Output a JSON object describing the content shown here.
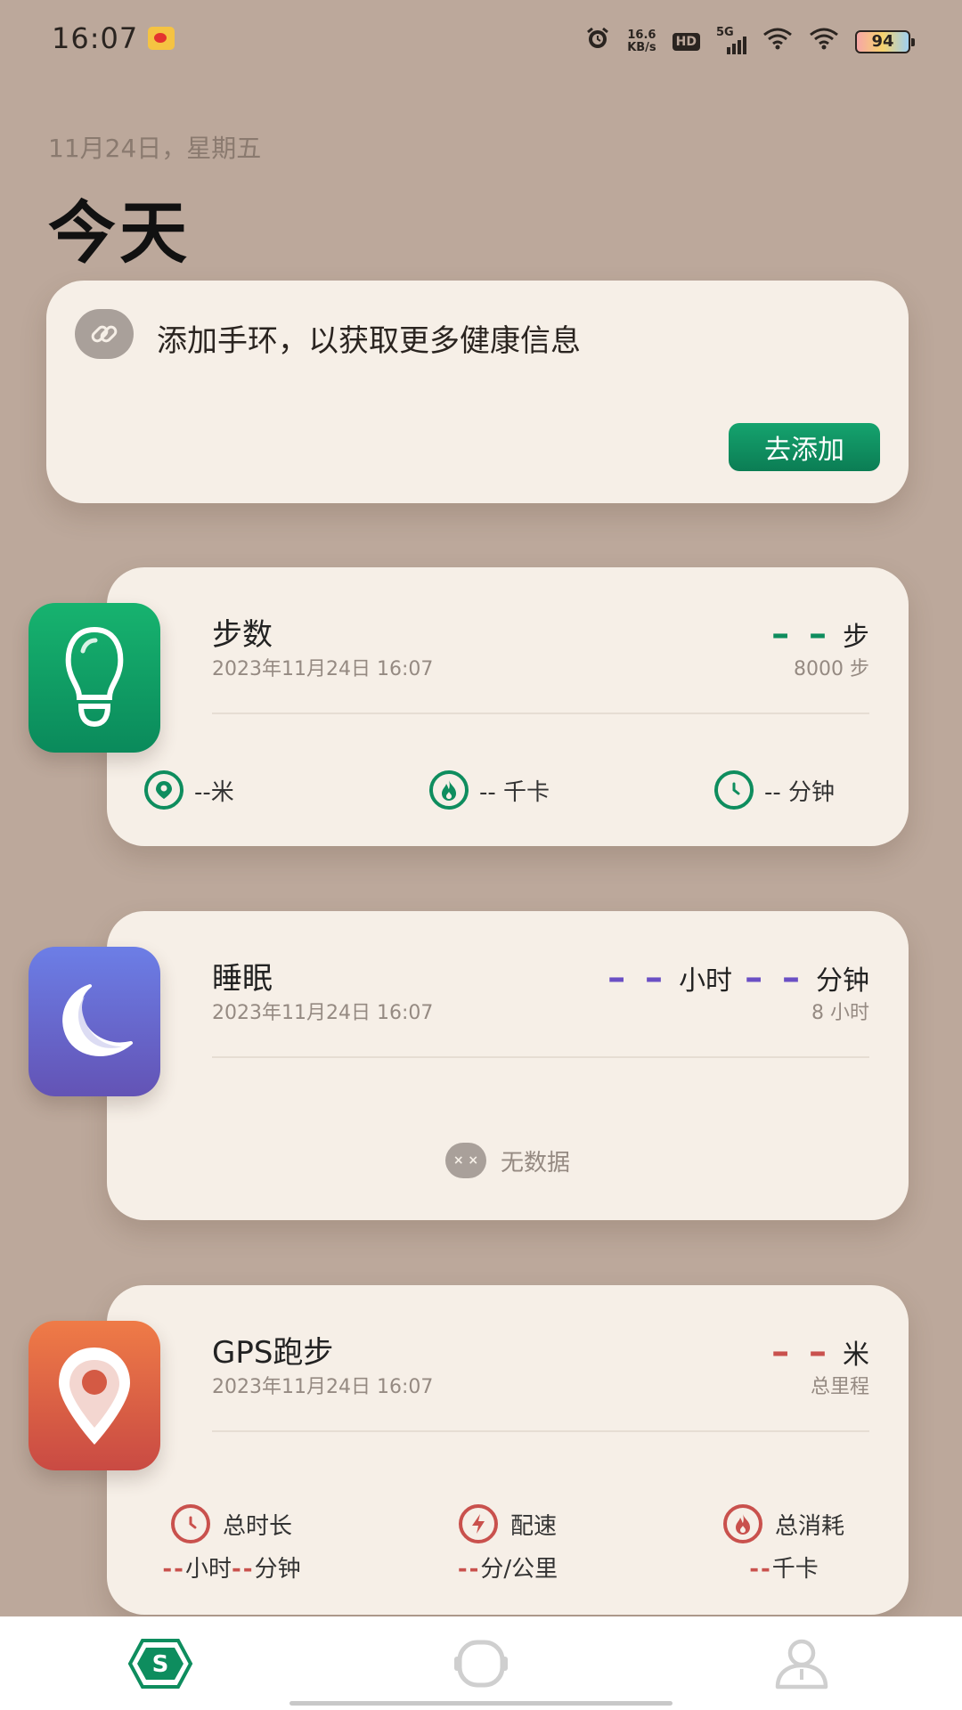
{
  "status_bar": {
    "time": "16:07",
    "net_speed_value": "16.6",
    "net_speed_unit": "KB/s",
    "hd": "HD",
    "network": "5G",
    "battery": "94"
  },
  "header": {
    "date": "11月24日，星期五",
    "title": "今天"
  },
  "band_card": {
    "message": "添加手环，以获取更多健康信息",
    "add_label": "去添加"
  },
  "steps": {
    "title": "步数",
    "time": "2023年11月24日 16:07",
    "value": "– –",
    "unit": "步",
    "goal": "8000 步",
    "accent": "#0e8d5e",
    "stats": [
      {
        "label": "--米"
      },
      {
        "label": "-- 千卡"
      },
      {
        "label": "-- 分钟"
      }
    ]
  },
  "sleep": {
    "title": "睡眠",
    "time": "2023年11月24日 16:07",
    "hours_value": "– –",
    "hours_unit": "小时",
    "minutes_value": "– –",
    "minutes_unit": "分钟",
    "goal": "8 小时",
    "accent": "#6a4fc4",
    "no_data": "无数据"
  },
  "gps": {
    "title": "GPS跑步",
    "time": "2023年11月24日 16:07",
    "value": "– –",
    "unit": "米",
    "sub": "总里程",
    "accent": "#c9514d",
    "stats": [
      {
        "label": "总时长",
        "value_dash_1": "--",
        "value_unit_1": "小时",
        "value_dash_2": "--",
        "value_unit_2": "分钟"
      },
      {
        "label": "配速",
        "value_dash_1": "--",
        "value_unit_1": "分/公里"
      },
      {
        "label": "总消耗",
        "value_dash_1": "--",
        "value_unit_1": "千卡"
      }
    ]
  },
  "nav": {
    "active_color": "#0e8d5e",
    "inactive_color": "#cfcfcf"
  }
}
